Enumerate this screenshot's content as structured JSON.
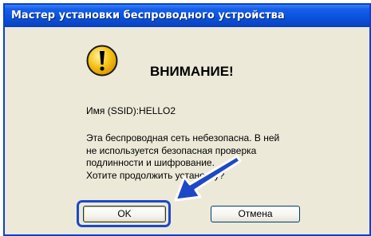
{
  "window": {
    "title": "Мастер установки беспроводного устройства"
  },
  "dialog": {
    "icon": "warning-exclamation-icon",
    "heading": "ВНИМАНИЕ!",
    "ssid_line": "Имя (SSID):HELLO2",
    "message_lines": [
      "Эта беспроводная сеть небезопасна. В ней",
      "не используется безопасная проверка",
      "подлинности и шифрование.",
      "Хотите продолжить установку?"
    ],
    "ok_label": "OK",
    "cancel_label": "Отмена"
  },
  "colors": {
    "title_bar": "#0b52df",
    "dialog_bg": "#ece9d8",
    "highlight": "#1d48c7",
    "warning_icon": "#f6c51a"
  }
}
